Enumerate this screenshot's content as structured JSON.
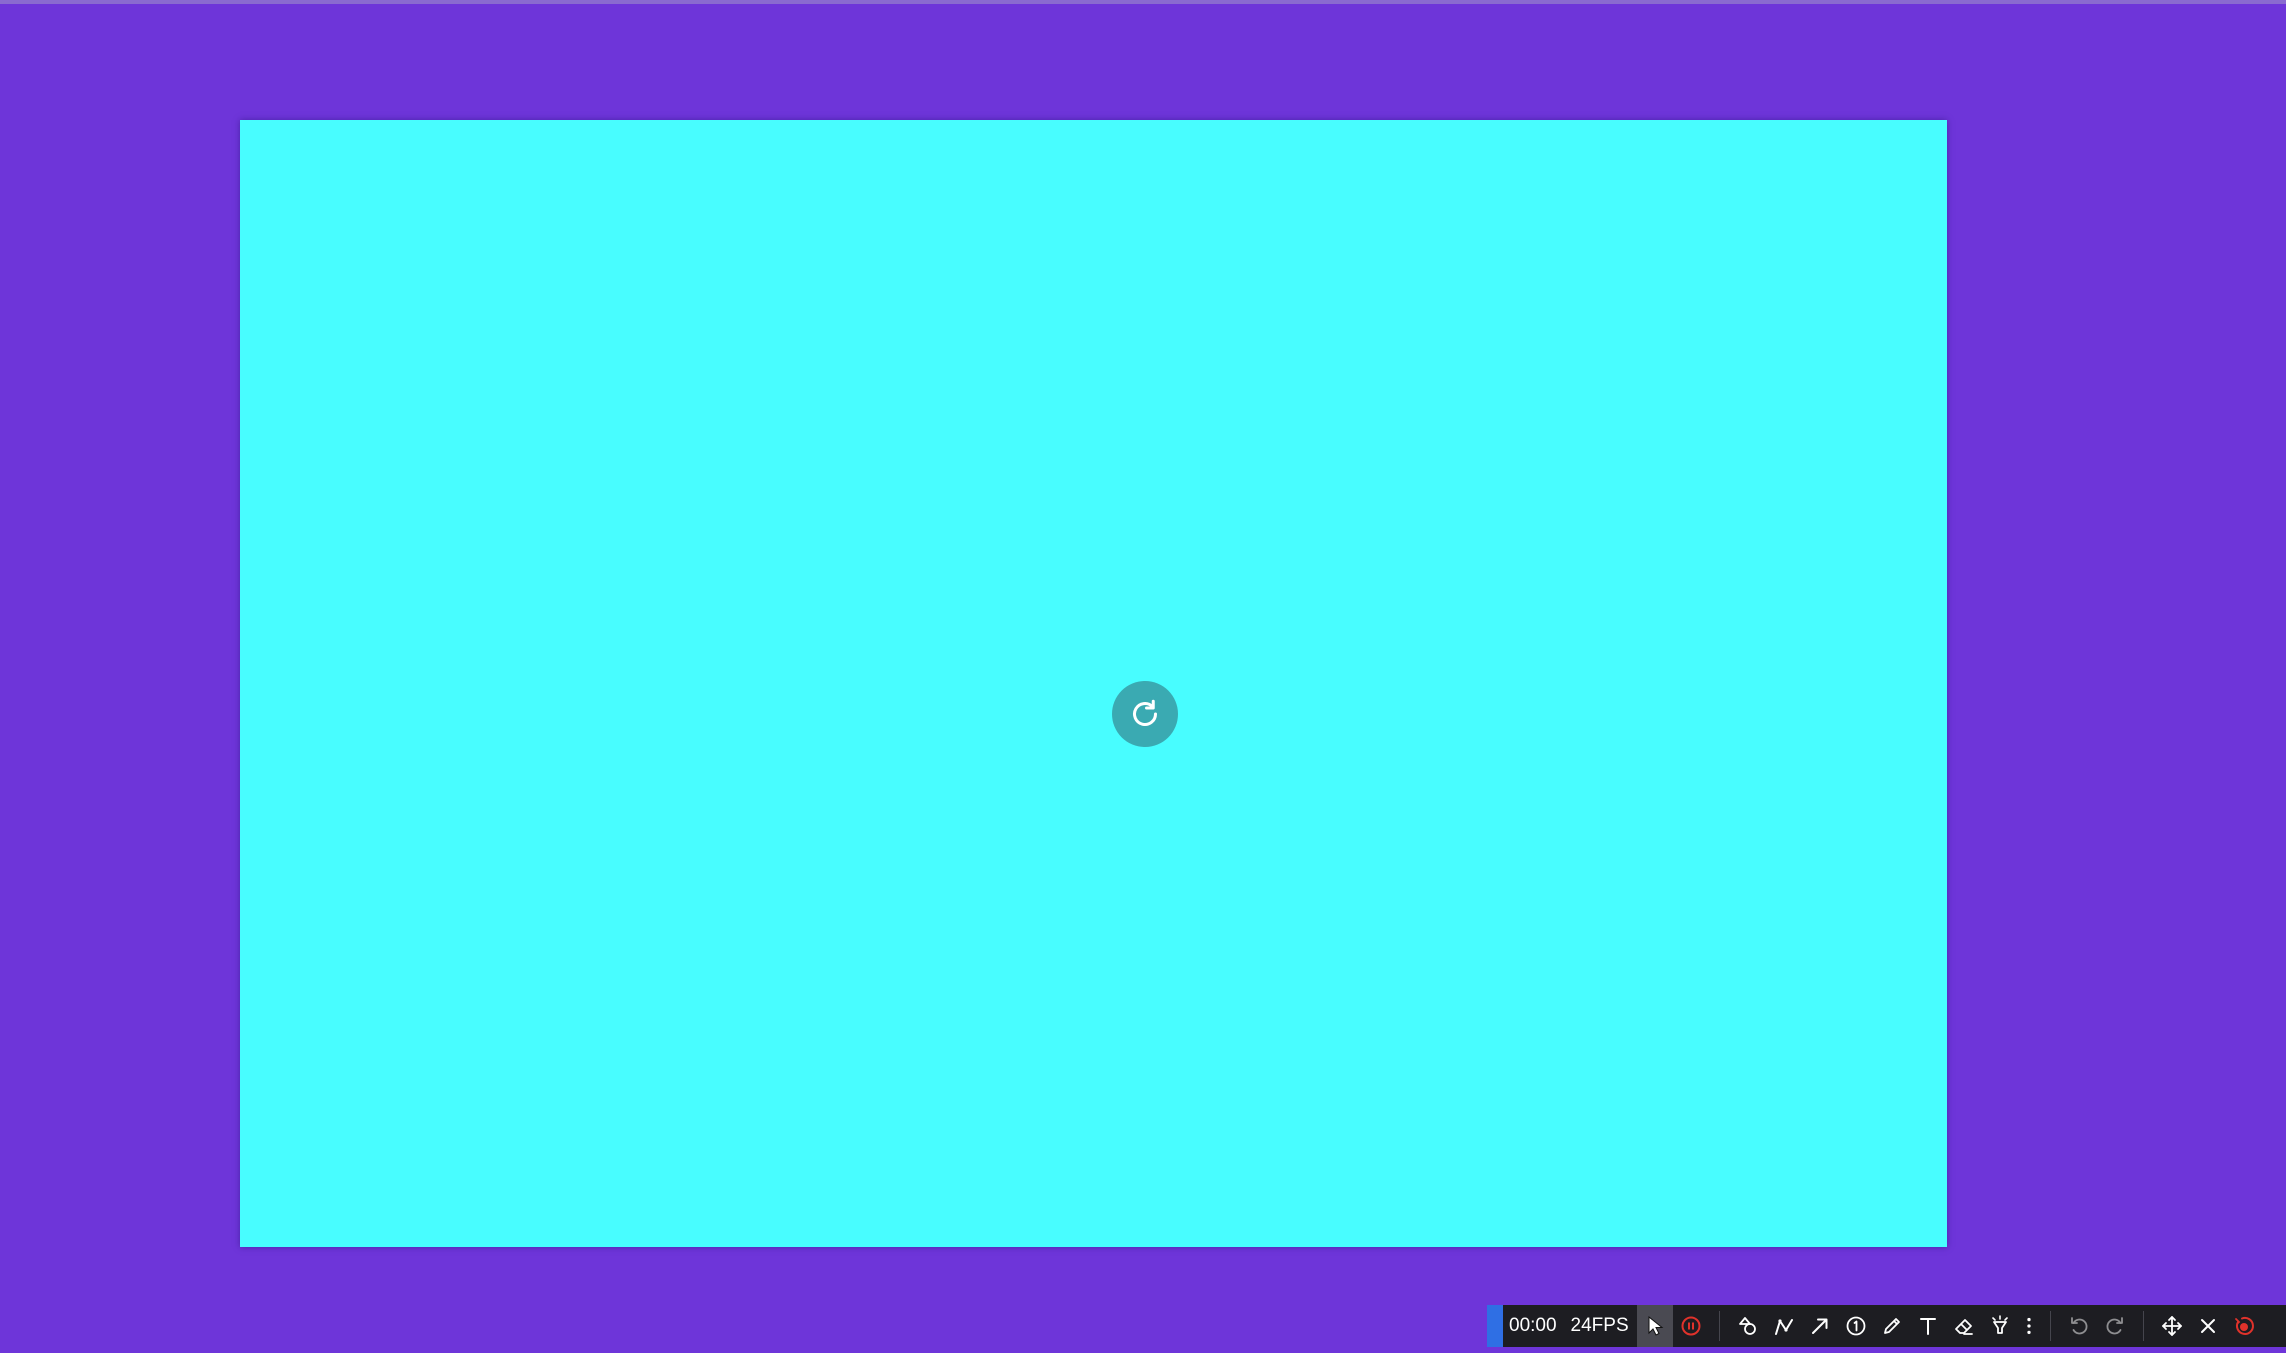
{
  "colors": {
    "desktop_background": "#6e35d9",
    "canvas_background": "#48fdff",
    "refresh_button": "#3aaab2",
    "toolbar_background": "#1d1d22",
    "toolbar_accent": "#2f6fe4",
    "record_red": "#e0322b"
  },
  "canvas": {
    "refresh_icon": "refresh-icon"
  },
  "toolbar": {
    "timer": "00:00",
    "fps": "24FPS",
    "tools": [
      {
        "name": "cursor",
        "icon": "cursor-icon",
        "active": true
      },
      {
        "name": "pause",
        "icon": "pause-circle-icon"
      },
      {
        "name": "shapes",
        "icon": "shapes-icon"
      },
      {
        "name": "line",
        "icon": "polyline-icon"
      },
      {
        "name": "arrow",
        "icon": "arrow-icon"
      },
      {
        "name": "step-number",
        "icon": "number-one-icon"
      },
      {
        "name": "pen",
        "icon": "pen-icon"
      },
      {
        "name": "text",
        "icon": "text-icon"
      },
      {
        "name": "eraser",
        "icon": "eraser-icon"
      },
      {
        "name": "spotlight",
        "icon": "spotlight-icon"
      },
      {
        "name": "more",
        "icon": "more-vertical-icon"
      },
      {
        "name": "undo",
        "icon": "undo-icon",
        "disabled": true
      },
      {
        "name": "redo",
        "icon": "redo-icon",
        "disabled": true
      },
      {
        "name": "move",
        "icon": "move-icon"
      },
      {
        "name": "close",
        "icon": "close-icon"
      },
      {
        "name": "stop-record",
        "icon": "record-icon"
      }
    ]
  }
}
